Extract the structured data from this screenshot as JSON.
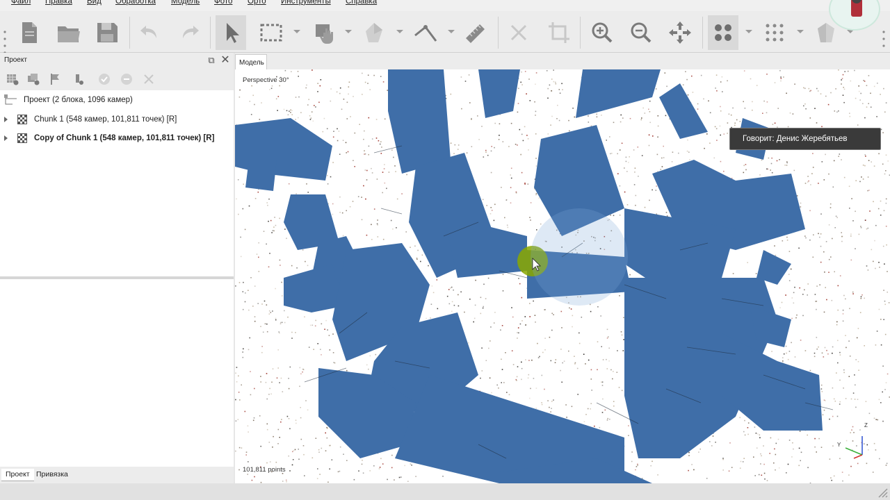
{
  "menu": [
    "Файл",
    "Правка",
    "Вид",
    "Обработка",
    "Модель",
    "Фото",
    "Орто",
    "Инструменты",
    "Справка"
  ],
  "toolbar": {
    "buttons": [
      "new-document",
      "open-folder",
      "save",
      "undo",
      "redo",
      "select-pointer",
      "rectangle-selection",
      "navigation-hand",
      "polygon-selection",
      "ruler-tool",
      "measure",
      "delete",
      "crop",
      "zoom-in",
      "zoom-out",
      "reset-view",
      "point-cloud",
      "dense-cloud",
      "model-shading"
    ]
  },
  "project_panel": {
    "title": "Проект",
    "tree": {
      "root": "Проект (2 блока, 1096 камер)",
      "chunks": [
        "Chunk 1 (548 камер, 101,811 точек) [R]",
        "Copy of Chunk 1 (548 камер, 101,811 точек) [R]"
      ]
    },
    "tabs": [
      "Проект",
      "Привязка"
    ]
  },
  "model_view": {
    "tab": "Модель",
    "perspective": "Perspective 30°",
    "points": "101,811 points",
    "axes": {
      "z": "Z",
      "y": "Y"
    }
  },
  "tooltip": "Говорит: Денис Жеребятьев",
  "colors": {
    "camera_blue": "#3f6ea8",
    "cursor_ring": "#8aa800",
    "toolbar_bg": "#ececec"
  }
}
